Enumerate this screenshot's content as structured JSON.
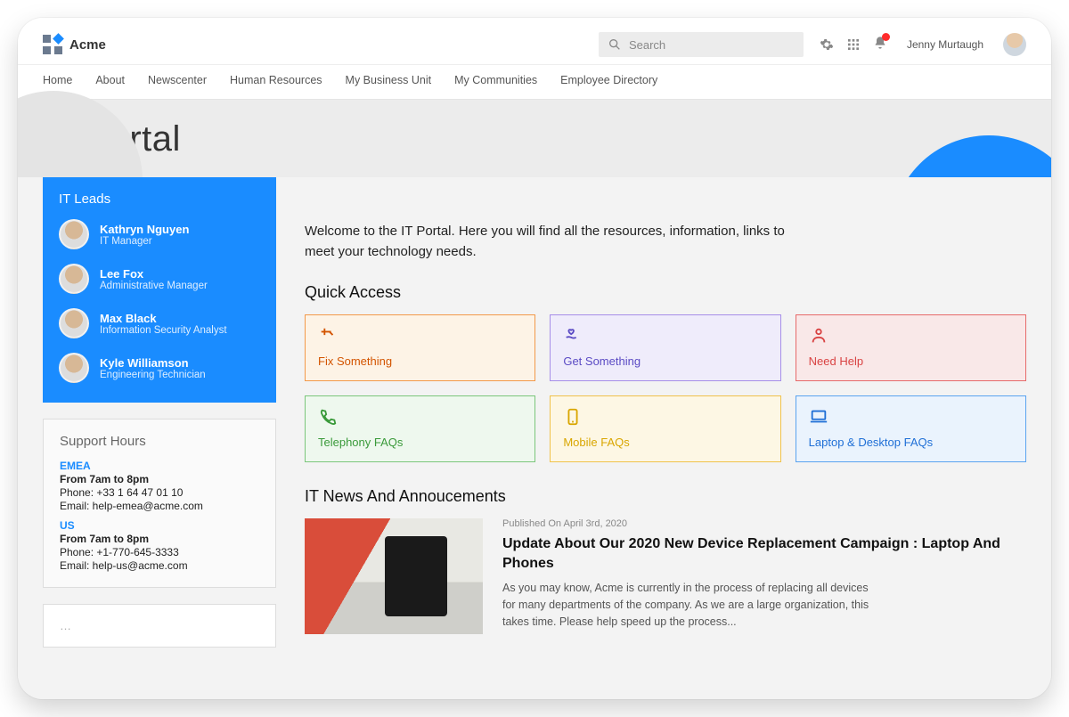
{
  "header": {
    "brand": "Acme",
    "search_placeholder": "Search",
    "user_name": "Jenny Murtaugh"
  },
  "nav": [
    "Home",
    "About",
    "Newscenter",
    "Human Resources",
    "My Business Unit",
    "My Communities",
    "Employee Directory"
  ],
  "page_title": "IT Portal",
  "leads": {
    "title": "IT Leads",
    "people": [
      {
        "name": "Kathryn Nguyen",
        "role": "IT Manager"
      },
      {
        "name": "Lee Fox",
        "role": "Administrative Manager"
      },
      {
        "name": "Max Black",
        "role": "Information Security Analyst"
      },
      {
        "name": "Kyle Williamson",
        "role": "Engineering Technician"
      }
    ]
  },
  "support": {
    "title": "Support Hours",
    "regions": [
      {
        "name": "EMEA",
        "hours": "From 7am to 8pm",
        "phone": "Phone: +33 1 64 47 01 10",
        "email": "Email: help-emea@acme.com"
      },
      {
        "name": "US",
        "hours": "From 7am to 8pm",
        "phone": "Phone: +1-770-645-3333",
        "email": "Email: help-us@acme.com"
      }
    ]
  },
  "intro": "Welcome to the IT Portal. Here you will find all the resources, information, links to meet your technology needs.",
  "quick_access": {
    "title": "Quick Access",
    "tiles": [
      {
        "label": "Fix Something",
        "tone": "orange",
        "icon": "hammer"
      },
      {
        "label": "Get Something",
        "tone": "purple",
        "icon": "hand-heart"
      },
      {
        "label": "Need Help",
        "tone": "red",
        "icon": "person"
      },
      {
        "label": "Telephony FAQs",
        "tone": "green",
        "icon": "phone"
      },
      {
        "label": "Mobile FAQs",
        "tone": "yellow",
        "icon": "mobile"
      },
      {
        "label": "Laptop & Desktop FAQs",
        "tone": "blue",
        "icon": "laptop"
      }
    ]
  },
  "news": {
    "title": "IT News And Annoucements",
    "published_label": "Published  On  April 3rd, 2020",
    "headline": "Update About Our 2020 New Device Replacement Campaign : Laptop And Phones",
    "excerpt": "As you may know, Acme is currently in the process of replacing all devices for many departments of the company. As we are a large organization, this takes time. Please help speed up the process..."
  }
}
